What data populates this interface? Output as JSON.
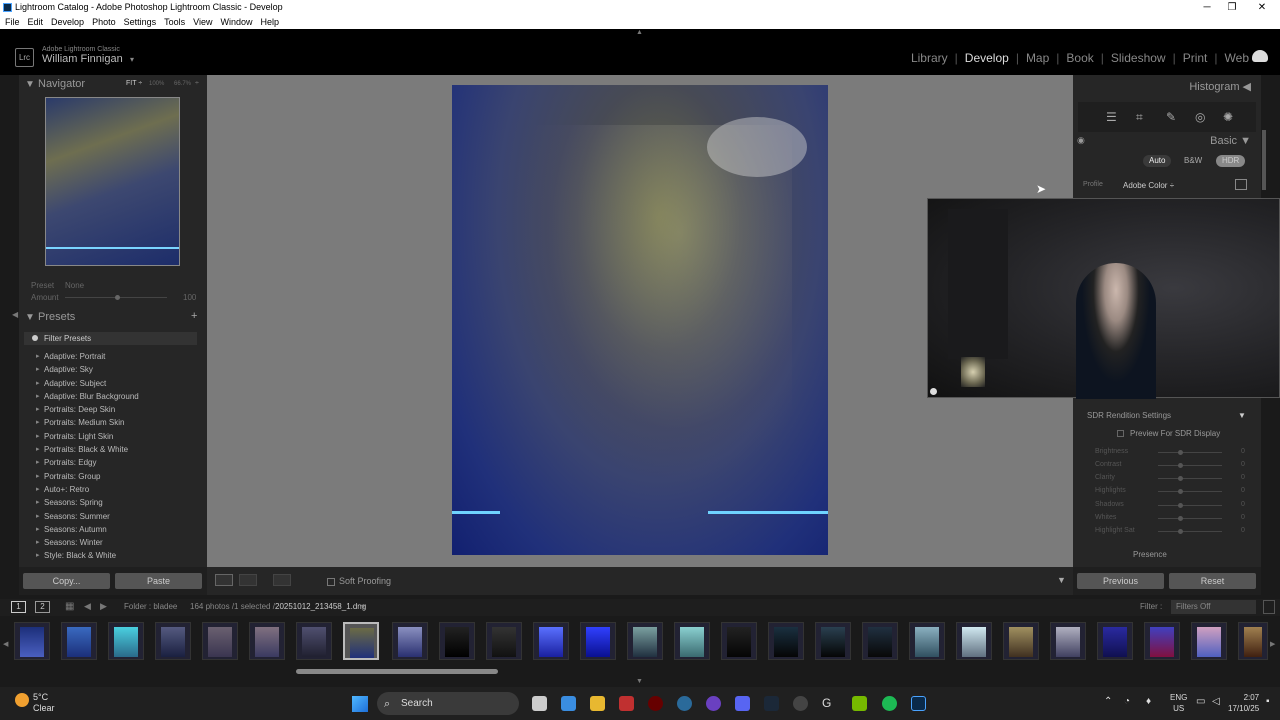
{
  "window": {
    "title": "Lightroom Catalog - Adobe Photoshop Lightroom Classic - Develop",
    "min": "─",
    "max": "❐",
    "close": "✕"
  },
  "menu": [
    "File",
    "Edit",
    "Develop",
    "Photo",
    "Settings",
    "Tools",
    "View",
    "Window",
    "Help"
  ],
  "identity": {
    "logo": "Lrc",
    "product": "Adobe Lightroom Classic",
    "user": "William Finnigan",
    "caret": "▾"
  },
  "modules": [
    "Library",
    "Develop",
    "Map",
    "Book",
    "Slideshow",
    "Print",
    "Web"
  ],
  "active_module": "Develop",
  "navigator": {
    "title": "Navigator",
    "fit": "FIT ÷",
    "z100": "100%",
    "z667": "66.7%",
    "more": "÷"
  },
  "preset_amount": {
    "preset": "Preset",
    "none": "None",
    "amount": "Amount",
    "value": "100"
  },
  "presets": {
    "title": "Presets",
    "add": "+",
    "filter": "Filter Presets",
    "items": [
      "Adaptive: Portrait",
      "Adaptive: Sky",
      "Adaptive: Subject",
      "Adaptive: Blur Background",
      "Portraits: Deep Skin",
      "Portraits: Medium Skin",
      "Portraits: Light Skin",
      "Portraits: Black & White",
      "Portraits: Edgy",
      "Portraits: Group",
      "Auto+: Retro",
      "Seasons: Spring",
      "Seasons: Summer",
      "Seasons: Autumn",
      "Seasons: Winter",
      "Style: Black & White"
    ]
  },
  "left_buttons": {
    "copy": "Copy...",
    "paste": "Paste"
  },
  "toolbar": {
    "soft_proofing": "Soft Proofing"
  },
  "right": {
    "histogram": "Histogram",
    "basic": "Basic",
    "treatment": [
      "Auto",
      "B&W",
      "HDR"
    ],
    "profile_label": "Profile",
    "profile_value": "Adobe Color ÷",
    "sdr_title": "SDR Rendition Settings",
    "sdr_preview": "Preview For SDR Display",
    "sliders": [
      {
        "label": "Brightness",
        "value": "0"
      },
      {
        "label": "Contrast",
        "value": "0"
      },
      {
        "label": "Clarity",
        "value": "0"
      },
      {
        "label": "Highlights",
        "value": "0"
      },
      {
        "label": "Shadows",
        "value": "0"
      },
      {
        "label": "Whites",
        "value": "0"
      },
      {
        "label": "Highlight Sat",
        "value": "0"
      }
    ],
    "presence": "Presence",
    "previous": "Previous",
    "reset": "Reset"
  },
  "filmbar": {
    "mon1": "1",
    "mon2": "2",
    "folder": "Folder : bladee",
    "count": "164 photos /1 selected /",
    "file": "20251012_213458_1.dng",
    "filter_label": "Filter :",
    "filter_value": "Filters Off"
  },
  "taskbar": {
    "temp": "5°C",
    "weather": "Clear",
    "search": "Search",
    "lang1": "ENG",
    "lang2": "US",
    "time": "2:07",
    "date": "17/10/25"
  },
  "colors": {
    "accent_light": "#6fd3ff",
    "panel": "#262626",
    "background": "#7b7b7b"
  }
}
